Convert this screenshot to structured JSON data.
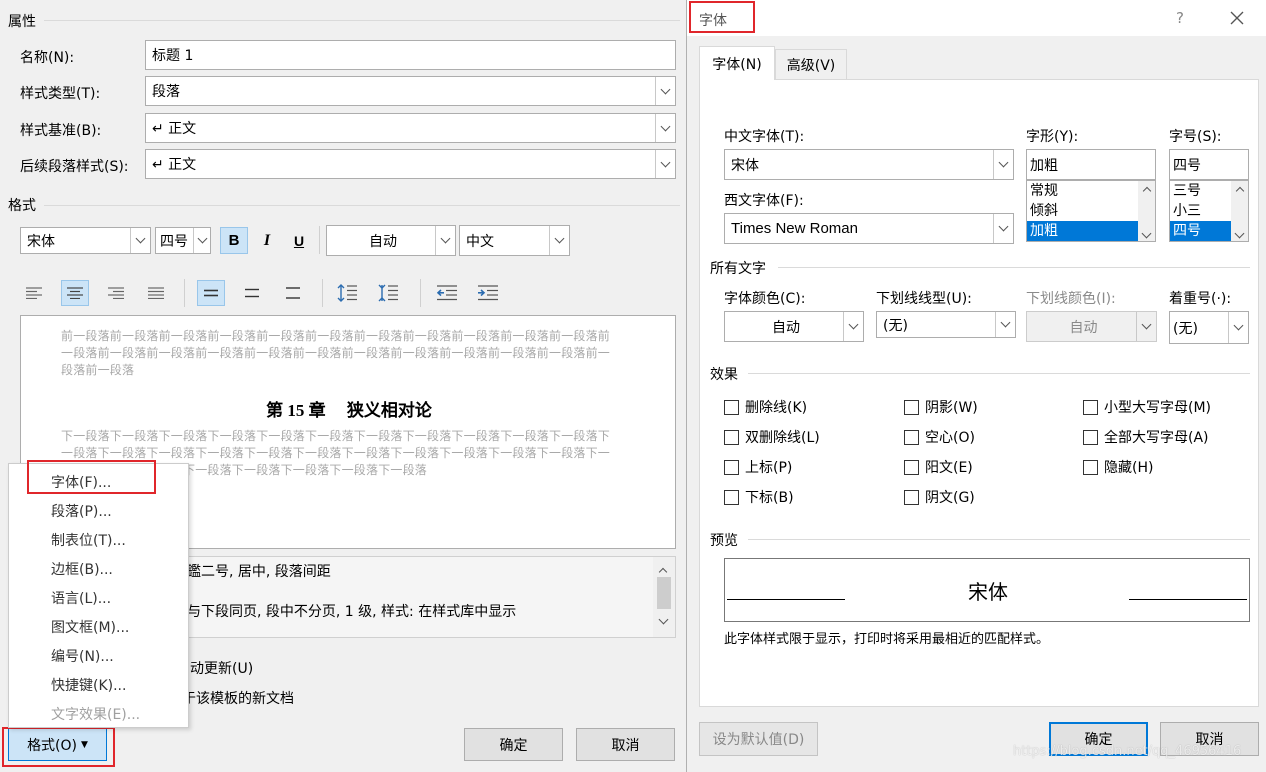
{
  "left_dialog": {
    "properties_title": "属性",
    "name_label": "名称(N):",
    "name_value": "标题 1",
    "style_type_label": "样式类型(T):",
    "style_type_value": "段落",
    "style_based_label": "样式基准(B):",
    "style_based_value": "↵ 正文",
    "next_style_label": "后续段落样式(S):",
    "next_style_value": "↵ 正文",
    "format_title": "格式",
    "font_value": "宋体",
    "size_value": "四号",
    "bold": "B",
    "italic": "I",
    "underline": "U",
    "color_value": "自动",
    "lang_value": "中文",
    "preview_prev": "前一段落前一段落前一段落前一段落前一段落前一段落前一段落前一段落前一段落前一段落前一段落前一段落前一段落前一段落前一段落前一段落前一段落前一段落前一段落前一段落前一段落前一段落前一段落前一段落",
    "preview_heading": "第 15 章　 狭义相对论",
    "preview_next": "下一段落下一段落下一段落下一段落下一段落下一段落下一段落下一段落下一段落下一段落下一段落下一段落下一段落下一段落下一段落下一段落下一段落下一段落下一段落下一段落下一段落下一段落下一段落下一段落下一段落下一段落下一段落下一段落下一段落下一段落",
    "desc_line1": "鑑二号, 居中, 段落间距",
    "desc_line2": "与下段同页, 段中不分页, 1 级, 样式: 在样式库中显示",
    "auto_update": "动更新(U)",
    "new_docs": "于该模板的新文档",
    "format_button": "格式(O)",
    "ok_button": "确定",
    "cancel_button": "取消"
  },
  "format_menu": {
    "items": [
      "字体(F)...",
      "段落(P)...",
      "制表位(T)...",
      "边框(B)...",
      "语言(L)...",
      "图文框(M)...",
      "编号(N)...",
      "快捷键(K)...",
      "文字效果(E)..."
    ]
  },
  "font_dialog": {
    "title": "字体",
    "help": "?",
    "tabs": [
      "字体(N)",
      "高级(V)"
    ],
    "cn_font_label": "中文字体(T):",
    "cn_font_value": "宋体",
    "west_font_label": "西文字体(F):",
    "west_font_value": "Times New Roman",
    "style_label": "字形(Y):",
    "style_value": "加粗",
    "style_options": [
      "常规",
      "倾斜",
      "加粗"
    ],
    "size_label": "字号(S):",
    "size_value": "四号",
    "size_options": [
      "三号",
      "小三",
      "四号"
    ],
    "all_text": "所有文字",
    "font_color_label": "字体颜色(C):",
    "font_color_value": "自动",
    "underline_type_label": "下划线线型(U):",
    "underline_type_value": "(无)",
    "underline_color_label": "下划线颜色(I):",
    "underline_color_value": "自动",
    "emphasis_label": "着重号(·):",
    "emphasis_value": "(无)",
    "effects_title": "效果",
    "effects": [
      "删除线(K)",
      "双删除线(L)",
      "上标(P)",
      "下标(B)",
      "阴影(W)",
      "空心(O)",
      "阳文(E)",
      "阴文(G)",
      "小型大写字母(M)",
      "全部大写字母(A)",
      "隐藏(H)"
    ],
    "preview_title": "预览",
    "preview_text": "宋体",
    "preview_note": "此字体样式限于显示，打印时将采用最相近的匹配样式。",
    "default_button": "设为默认值(D)",
    "ok_button": "确定",
    "cancel_button": "取消",
    "watermark": "https://blog.csdn.net/qq_46956416"
  },
  "colors": {
    "highlight_red": "#e0262b",
    "selection_blue": "#0078d7",
    "toolbar_on": "#cce4f7"
  }
}
